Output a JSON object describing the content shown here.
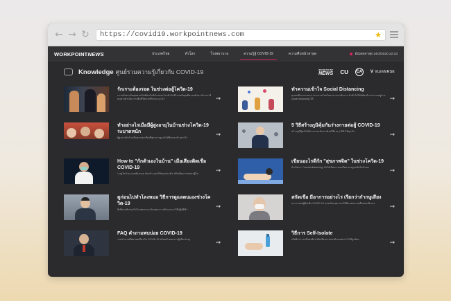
{
  "browser": {
    "url": "https://covid19.workpointnews.com"
  },
  "site": {
    "logo_main": "WORKPOINT",
    "logo_em": "NEWS",
    "nav": [
      {
        "label": "ประเทศไทย"
      },
      {
        "label": "ทั่วโลก"
      },
      {
        "label": "โรงพยาบาล"
      },
      {
        "label": "ความรู้สู้ COVID-19"
      },
      {
        "label": "ความคืบหน้าล่าสุด"
      }
    ],
    "update_text": "อัปเดตล่าสุด 24/3/2020 22:23"
  },
  "knowledge": {
    "title": "Knowledge",
    "subtitle": "ศูนย์รวมความรู้เกี่ยวกับ COVID-19",
    "partners": {
      "p1_small": "WORKPOINT",
      "p1_big": "NEWS",
      "p2": "CU",
      "p3": "CA",
      "p4": "VLEVERSE"
    }
  },
  "cards": [
    {
      "title": "รักเราะต้องรอด ในช่วงต่อสู้โควิด-19",
      "desc": "การกลับมาเป็นสุขพวกกับเพื่อนใกล้บ้านและร้านค้าใกล้ร้านหลังยุคที่ชะลอตัวลง บ้านเรามีคนต่างดำเนินการเพิ่มชีวิตตามที่ระยะแนะนำ"
    },
    {
      "title": "ทำความเข้าใจ Social Distancing",
      "desc": "ทุกคนที่จะเอาชนะการระบาดโรคในอาหารจะเป็นการ ถ้าทำไม่ได้ก็ต้องถ้าสามารถอยู่ห่าง social distancing ได้"
    },
    {
      "title": "ทำอย่างไรเมื่อมีผู้สูงอายุในบ้านช่วงโควิด-19 ระบาดหนัก",
      "desc": "ผู้สูงอายุในบ้านคือคนกลุ่มเสี่ยงที่สุด ควรดูแลใกล้ชิดและทำอย่างไร"
    },
    {
      "title": "5 วิธีสร้างภูมิคุ้มกันร่างกายต่อสู้ COVID-19",
      "desc": "สร้างภูมิคุ้มกันให้ร่างกายแข็งแรงด้วยวิธีง่าย ๆ ที่ทำได้ทุกวัน"
    },
    {
      "title": "How to \"กักตัวเองในบ้าน\" เมื่อเสี่ยงติดเชื้อ COVID-19",
      "desc": "1.อยู่ในบ้าน แยกห้องนอน ห้องน้ำ แยกใช้ของส่วนตัว หลีกเลี่ยงการพบปะผู้อื่น"
    },
    {
      "title": "เขียนอะไรดีกัก \"สุขภาพจิต\" ในช่วงโควิด-19",
      "desc": "ถ้าเกิดการ \"social distancing\" ทำให้เกิดความเครียด ลองดูแลจิตใจตัวเอง"
    },
    {
      "title": "ดูก่อนไปทำโลงหมอ วิธีการดูแลตนเองช่วงโควิด-19",
      "desc": "สิ่งที่ควรทำก่อนไปโรงพยาบาล สังเกตอาการตัวเองและวิธีปฏิบัติตัว"
    },
    {
      "title": "สกัดเชื้อ มีอาการอย่างไร เรียกว่ากำกษูเสี่ยง",
      "desc": "อาการของผู้ติดเชื้อ COVID-19 แบ่งเป็นกลุ่ม และวิธีสังเกตความเสี่ยงของตัวเอง"
    },
    {
      "title": "FAQ คำถามพบบ่อย COVID-19",
      "desc": "รวมคำถามที่พบบ่อยเกี่ยวกับ COVID-19 พร้อมคำตอบจากผู้เชี่ยวชาญ"
    },
    {
      "title": "วิธีการ Self-Isolate",
      "desc": "เมื่อมีอาการหรือสงสัยว่าติดเชื้อ ควรแยกตัวเองอย่างไรให้ถูกต้อง"
    }
  ],
  "colors": {
    "accent": "#e0245e",
    "panel": "#2b2b2d",
    "sitebar": "#333336"
  }
}
